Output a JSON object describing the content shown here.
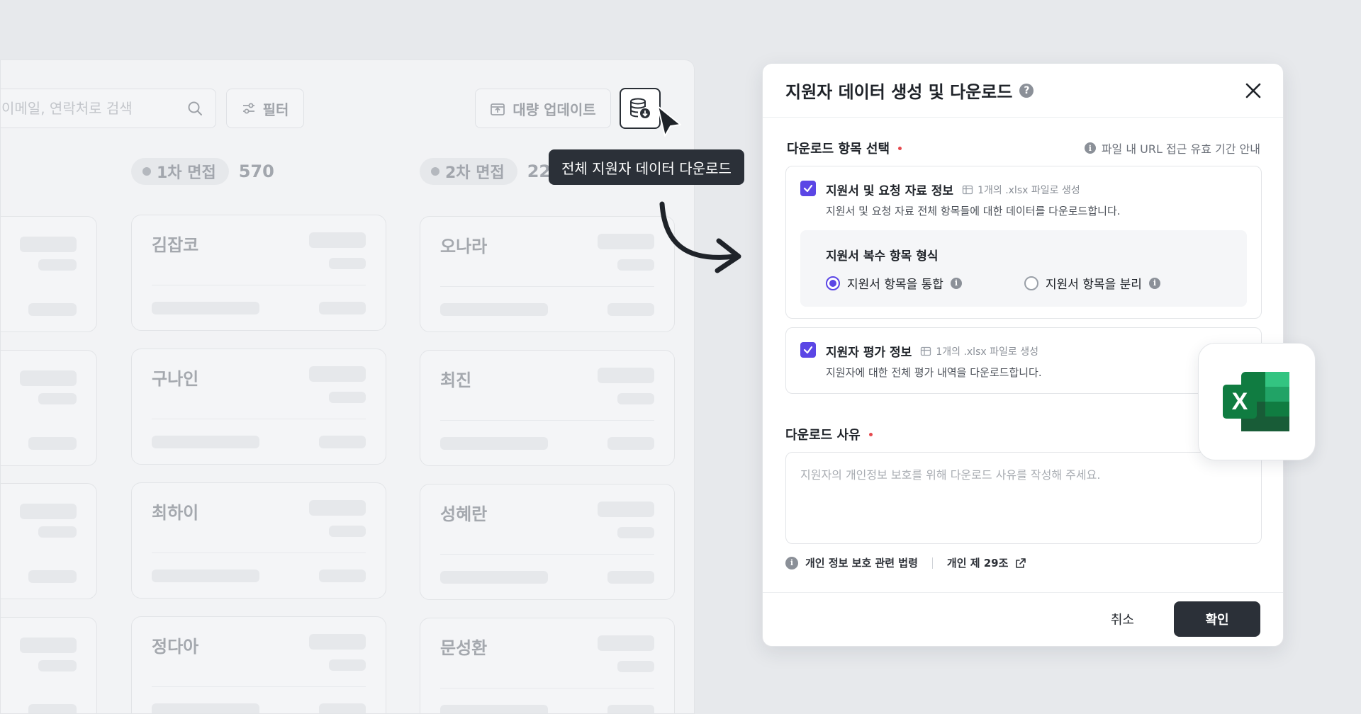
{
  "toolbar": {
    "search_placeholder": "이메일, 연락처로 검색",
    "filter_label": "필터",
    "bulk_update_label": "대량 업데이트"
  },
  "tooltip": "전체 지원자 데이터 다운로드",
  "columns": [
    {
      "label": "1차 면접",
      "count": "570",
      "cards": [
        "김잡코",
        "구나인",
        "최하이",
        "정다아"
      ]
    },
    {
      "label": "2차 면접",
      "count": "22",
      "cards": [
        "오나라",
        "최진",
        "성혜란",
        "문성환"
      ]
    }
  ],
  "modal": {
    "title": "지원자 데이터 생성 및 다운로드",
    "section_items_label": "다운로드 항목 선택",
    "url_note": "파일 내 URL 접근 유효 기간 안내",
    "option1": {
      "title": "지원서 및 요청 자료 정보",
      "file_note": "1개의 .xlsx 파일로 생성",
      "desc": "지원서 및 요청 자료 전체 항목들에 대한 데이터를 다운로드합니다.",
      "checked": true,
      "format_label": "지원서 복수 항목 형식",
      "radio_merge": "지원서 항목을 통합",
      "radio_split": "지원서 항목을 분리",
      "selected": "merge"
    },
    "option2": {
      "title": "지원자 평가 정보",
      "file_note": "1개의 .xlsx 파일로 생성",
      "desc": "지원자에 대한 전체 평가 내역을 다운로드합니다.",
      "checked": true
    },
    "reason_label": "다운로드 사유",
    "reason_placeholder": "지원자의 개인정보 보호를 위해 다운로드 사유를 작성해 주세요.",
    "law_label": "개인 정보 보호 관련 법령",
    "law_link": "개인 제 29조",
    "cancel": "취소",
    "confirm": "확인"
  },
  "excel_badge": {
    "letter": "X",
    "icon": "excel-icon",
    "color": "#107c41"
  },
  "colors": {
    "accent": "#5b46e5",
    "dark_button": "#2b3038",
    "required_dot": "#e5484d"
  }
}
